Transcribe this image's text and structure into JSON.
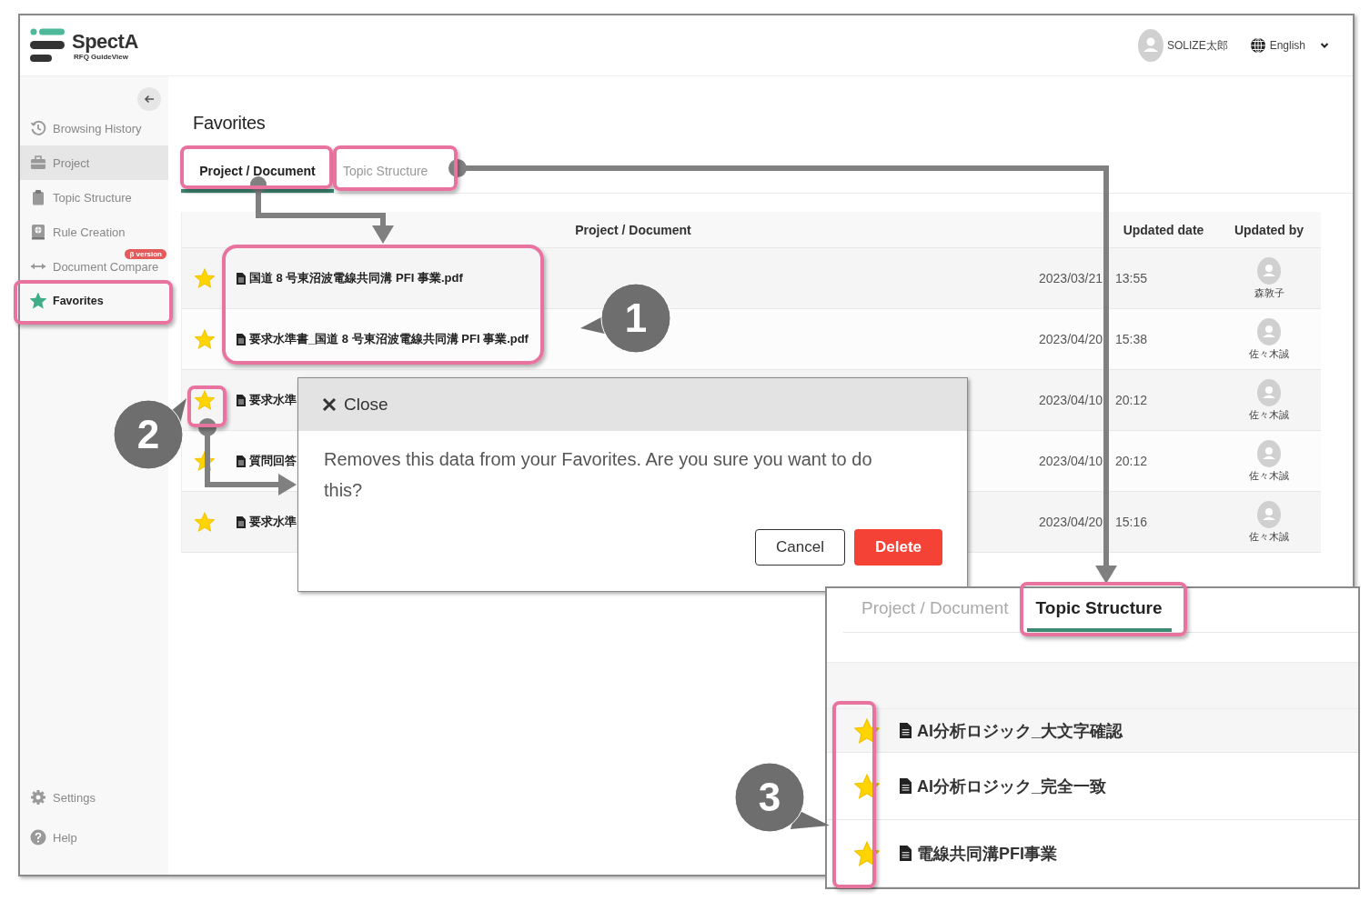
{
  "app": {
    "logo": "SpectA",
    "logo_sub": "RFQ GuideView"
  },
  "user": {
    "name": "SOLIZE太郎"
  },
  "language": {
    "label": "English"
  },
  "sidebar": {
    "items": [
      {
        "label": "Browsing History",
        "selected": false,
        "hovered": false
      },
      {
        "label": "Project",
        "selected": false,
        "hovered": true
      },
      {
        "label": "Topic Structure",
        "selected": false,
        "hovered": false
      },
      {
        "label": "Rule Creation",
        "selected": false,
        "hovered": false
      },
      {
        "label": "Document Compare",
        "selected": false,
        "hovered": false,
        "badge": "β version"
      },
      {
        "label": "Favorites",
        "selected": true,
        "hovered": false
      }
    ],
    "footer": [
      {
        "label": "Settings"
      },
      {
        "label": "Help"
      }
    ]
  },
  "page_title": "Favorites",
  "tabs": [
    {
      "label": "Project / Document",
      "selected": true
    },
    {
      "label": "Topic Structure",
      "selected": false
    }
  ],
  "table": {
    "columns": [
      "Project / Document",
      "Updated date",
      "Updated by"
    ],
    "rows": [
      {
        "starred": true,
        "name": "国道 8 号東沼波電線共同溝 PFI 事業.pdf",
        "date": "2023/03/21 13:55",
        "user": "森敦子"
      },
      {
        "starred": true,
        "name": "要求水準書_国道 8 号東沼波電線共同溝 PFI 事業.pdf",
        "date": "2023/04/20 15:38",
        "user": "佐々木誠"
      },
      {
        "starred": true,
        "name": "要求水準",
        "date": "2023/04/10 20:12",
        "user": "佐々木誠"
      },
      {
        "starred": true,
        "name": "質問回答",
        "date": "2023/04/10 20:12",
        "user": "佐々木誠"
      },
      {
        "starred": true,
        "name": "要求水準",
        "date": "2023/04/20 15:16",
        "user": "佐々木誠"
      }
    ]
  },
  "dialog": {
    "close": "Close",
    "message": "Removes this data from your Favorites. Are you sure you want to do this?",
    "buttons": [
      {
        "label": "Cancel",
        "kind": "secondary"
      },
      {
        "label": "Delete",
        "kind": "danger"
      }
    ]
  },
  "inset": {
    "tabs": [
      {
        "label": "Project / Document",
        "selected": false
      },
      {
        "label": "Topic Structure",
        "selected": true
      }
    ],
    "rows": [
      {
        "starred": true,
        "name": "AI分析ロジック_大文字確認"
      },
      {
        "starred": true,
        "name": "AI分析ロジック_完全一致"
      },
      {
        "starred": true,
        "name": "電線共同溝PFI事業"
      }
    ]
  },
  "callouts": [
    "1",
    "2",
    "3"
  ]
}
